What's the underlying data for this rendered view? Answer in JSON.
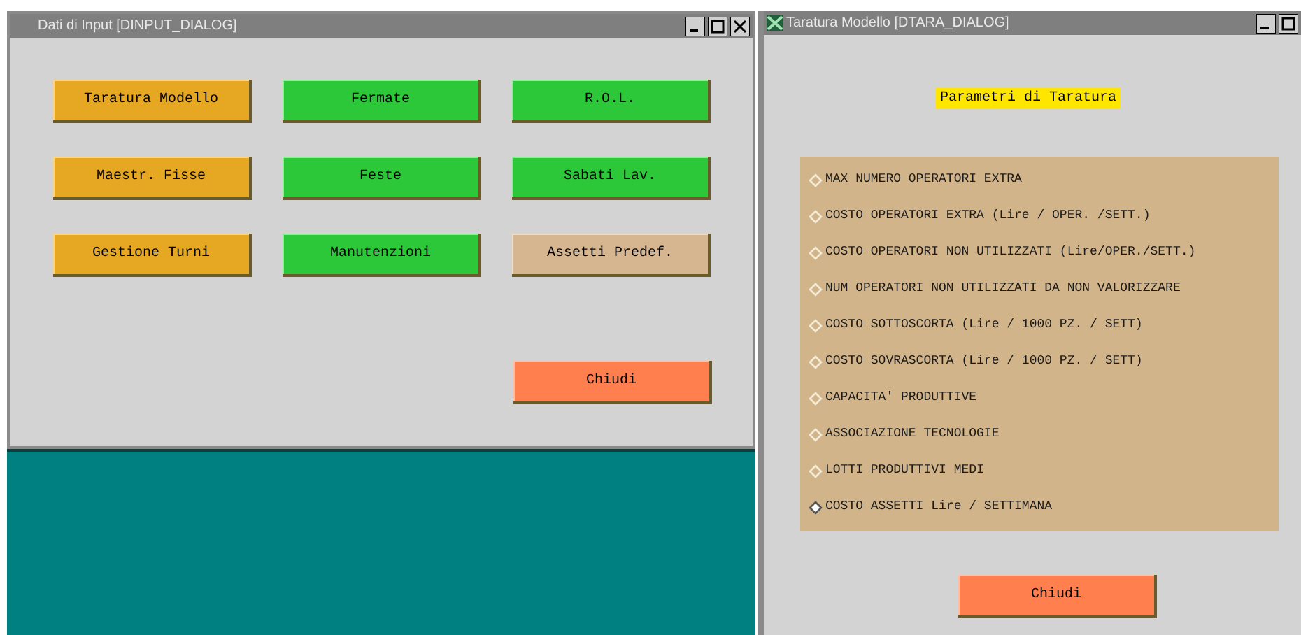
{
  "input_window": {
    "title": "Dati di Input [DINPUT_DIALOG]",
    "buttons": [
      {
        "label": "Taratura Modello",
        "kind": "orange"
      },
      {
        "label": "Fermate",
        "kind": "green"
      },
      {
        "label": "R.O.L.",
        "kind": "green"
      },
      {
        "label": "Maestr. Fisse",
        "kind": "orange"
      },
      {
        "label": "Feste",
        "kind": "green"
      },
      {
        "label": "Sabati Lav.",
        "kind": "green"
      },
      {
        "label": "Gestione Turni",
        "kind": "orange"
      },
      {
        "label": "Manutenzioni",
        "kind": "green"
      },
      {
        "label": "Assetti Predef.",
        "kind": "tan"
      }
    ],
    "close_button": "Chiudi"
  },
  "calibration_window": {
    "title": "Taratura Modello [DTARA_DIALOG]",
    "heading": "Parametri di Taratura",
    "options": [
      {
        "label": "MAX NUMERO OPERATORI EXTRA",
        "selected": false
      },
      {
        "label": "COSTO OPERATORI EXTRA (Lire / OPER. /SETT.)",
        "selected": false
      },
      {
        "label": "COSTO OPERATORI NON UTILIZZATI (Lire/OPER./SETT.)",
        "selected": false
      },
      {
        "label": "NUM OPERATORI NON UTILIZZATI DA NON VALORIZZARE",
        "selected": false
      },
      {
        "label": "COSTO SOTTOSCORTA (Lire / 1000 PZ. / SETT)",
        "selected": false
      },
      {
        "label": "COSTO SOVRASCORTA (Lire / 1000 PZ. / SETT)",
        "selected": false
      },
      {
        "label": "CAPACITA' PRODUTTIVE",
        "selected": false
      },
      {
        "label": "ASSOCIAZIONE TECNOLOGIE",
        "selected": false
      },
      {
        "label": "LOTTI PRODUTTIVI MEDI",
        "selected": false
      },
      {
        "label": "COSTO ASSETTI Lire / SETTIMANA",
        "selected": true
      }
    ],
    "close_button": "Chiudi"
  }
}
